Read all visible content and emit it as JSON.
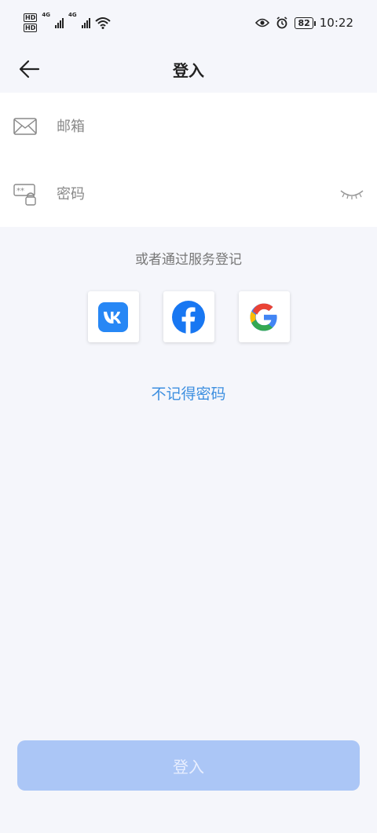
{
  "status_bar": {
    "hd1": "HD",
    "hd2": "HD",
    "net1": "4G",
    "net2": "4G",
    "battery": "82",
    "time": "10:22"
  },
  "header": {
    "title": "登入",
    "back_icon": "arrow-left-icon"
  },
  "form": {
    "email_placeholder": "邮箱",
    "email_icon": "envelope-icon",
    "password_placeholder": "密码",
    "password_icon": "password-lock-icon",
    "eye_icon": "eye-closed-icon"
  },
  "alt_login": {
    "label": "或者通过服务登记",
    "providers": [
      {
        "name": "vk",
        "icon": "vk-icon",
        "color": "#2787f5"
      },
      {
        "name": "facebook",
        "icon": "facebook-icon",
        "color": "#1877f2"
      },
      {
        "name": "google",
        "icon": "google-icon",
        "color": "#4285f4"
      }
    ]
  },
  "forgot_password": "不记得密码",
  "login_button": "登入",
  "colors": {
    "accent": "#3d8fe0",
    "button_disabled": "#abc6f6",
    "background": "#f5f6fb"
  }
}
